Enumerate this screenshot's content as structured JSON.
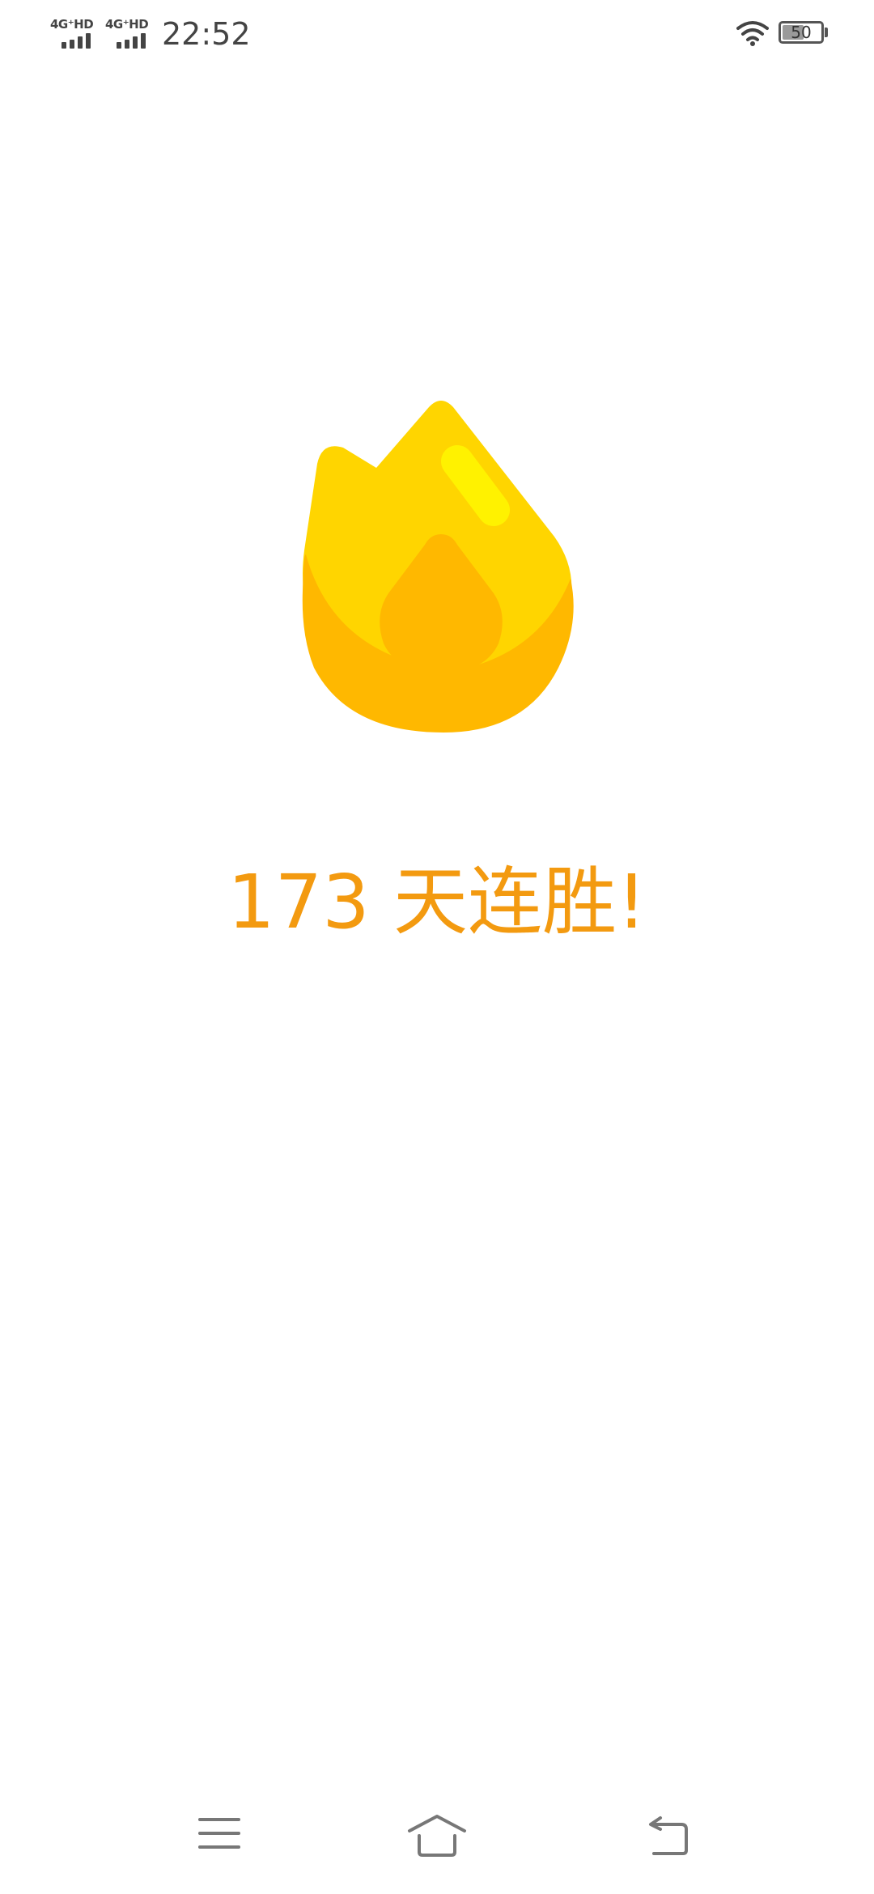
{
  "status_bar": {
    "sim1_label": "4G⁺HD",
    "sim2_label": "4G⁺HD",
    "time": "22:52",
    "battery_level": "50",
    "icons": [
      "signal-bars-icon",
      "wifi-icon",
      "battery-icon"
    ]
  },
  "main": {
    "flame_icon": "flame-icon",
    "streak_text": "173 天连胜!"
  },
  "colors": {
    "flame_outer": "#FFD500",
    "flame_inner": "#FFB800",
    "flame_highlight": "#FFF200",
    "streak_text": "#F39A10"
  },
  "nav_bar": {
    "icons": [
      "menu-icon",
      "home-icon",
      "back-icon"
    ]
  }
}
